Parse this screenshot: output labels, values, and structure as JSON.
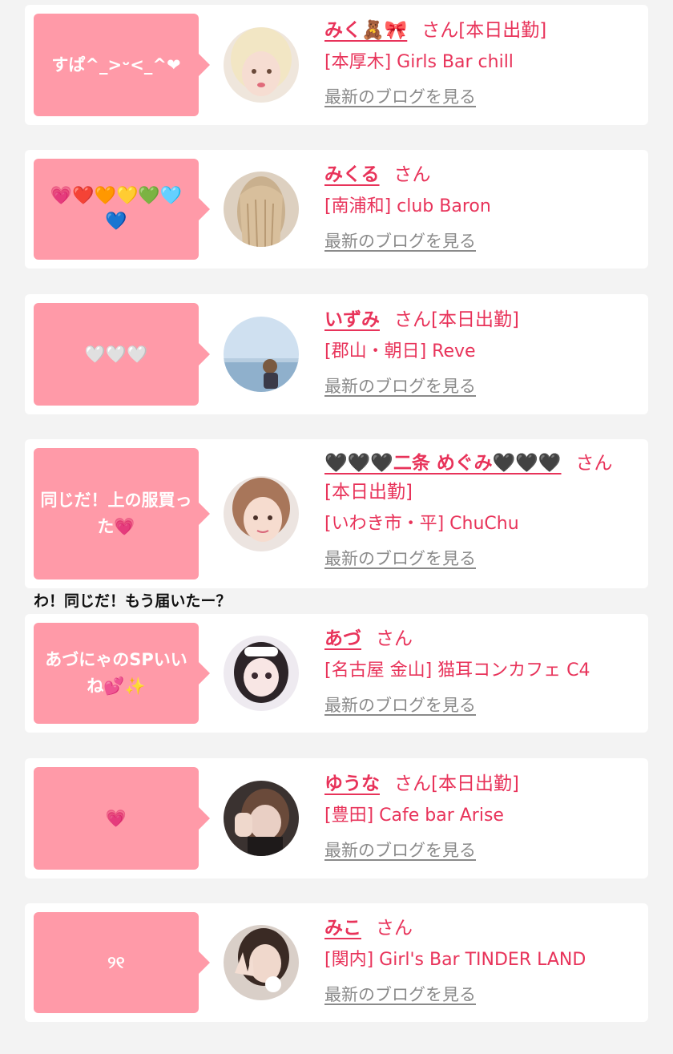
{
  "entries": [
    {
      "comment": "すぱ^_>ᵕ<_^❤",
      "name": "みく🧸🎀",
      "honorific": "さん",
      "status": "[本日出勤]",
      "shop": "[本厚木] Girls Bar chill",
      "blog_link": "最新のブログを見る"
    },
    {
      "comment": "💗❤️🧡💛💚🩵💙",
      "name": "みくる",
      "honorific": "さん",
      "status": "",
      "shop": "[南浦和] club Baron",
      "blog_link": "最新のブログを見る"
    },
    {
      "comment": "🤍🤍🤍",
      "name": "いずみ",
      "honorific": "さん",
      "status": "[本日出勤]",
      "shop": "[郡山・朝日] Reve",
      "blog_link": "最新のブログを見る"
    },
    {
      "comment": "同じだ！上の服買った💗",
      "name": "🖤🖤🖤二条 めぐみ🖤🖤🖤",
      "honorific": "さん",
      "status": "[本日出勤]",
      "shop": "[いわき市・平] ChuChu",
      "blog_link": "最新のブログを見る"
    },
    {
      "comment": "あづにゃのSPいいね💕✨",
      "name": "あづ",
      "honorific": "さん",
      "status": "",
      "shop": "[名古屋 金山] 猫耳コンカフェ C4",
      "blog_link": "最新のブログを見る"
    },
    {
      "comment": "💗",
      "name": "ゆうな",
      "honorific": "さん",
      "status": "[本日出勤]",
      "shop": "[豊田] Cafe bar Arise",
      "blog_link": "最新のブログを見る"
    },
    {
      "comment": "୨୧",
      "name": "みこ",
      "honorific": "さん",
      "status": "",
      "shop": "[関内] Girl's Bar TINDER LAND",
      "blog_link": "最新のブログを見る"
    }
  ],
  "overlay_comment": "わ！同じだ！もう届いたー？",
  "colors": {
    "accent": "#e8335a",
    "bubble": "#ff9aa8",
    "link_gray": "#8a8a8a",
    "background": "#f3f3f3"
  }
}
